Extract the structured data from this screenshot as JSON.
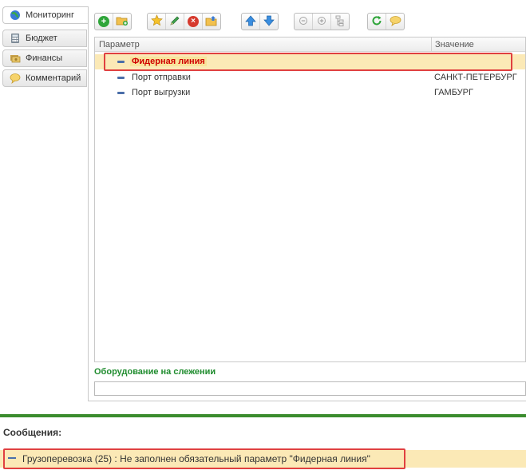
{
  "tabs": [
    {
      "label": "Мониторинг",
      "icon": "globe-icon",
      "active": true
    },
    {
      "label": "Бюджет",
      "icon": "calculator-icon",
      "active": false
    },
    {
      "label": "Финансы",
      "icon": "money-icon",
      "active": false
    },
    {
      "label": "Комментарий",
      "icon": "speech-bubble-icon",
      "active": false
    }
  ],
  "toolbar": {
    "buttons": [
      "add-icon",
      "add-folder-icon",
      "star-icon",
      "edit-pencil-icon",
      "delete-icon",
      "move-to-folder-icon",
      "move-up-icon",
      "move-down-icon",
      "collapse-icon",
      "expand-icon",
      "tree-structure-icon",
      "refresh-icon",
      "comment-icon"
    ]
  },
  "grid": {
    "columns": [
      "Параметр",
      "Значение"
    ],
    "rows": [
      {
        "param": "Фидерная линия",
        "value": "",
        "error": true
      },
      {
        "param": "Порт отправки",
        "value": "САНКТ-ПЕТЕРБУРГ",
        "error": false
      },
      {
        "param": "Порт выгрузки",
        "value": "ГАМБУРГ",
        "error": false
      }
    ]
  },
  "equipment": {
    "label": "Оборудование на слежении",
    "value": ""
  },
  "messages": {
    "title": "Сообщения:",
    "items": [
      "Грузоперевозка (25) : Не заполнен обязательный параметр \"Фидерная линия\""
    ]
  },
  "colors": {
    "accent_green": "#3b8c2e",
    "error_red": "#d00000",
    "selection": "#fbe9b6"
  }
}
